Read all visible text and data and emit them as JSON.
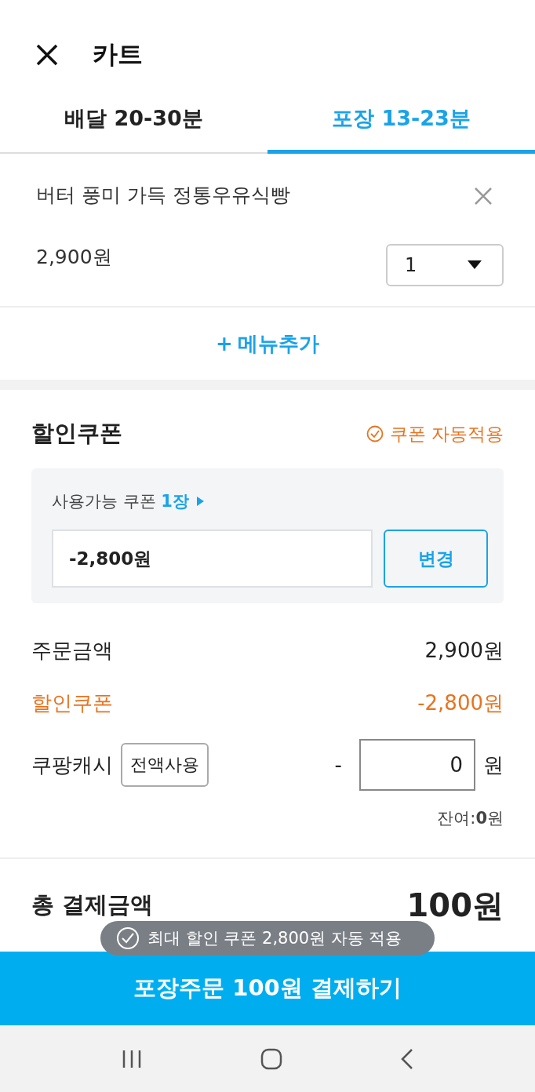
{
  "header": {
    "title": "카트"
  },
  "tabs": [
    {
      "label": "배달 20-30분",
      "selected": false
    },
    {
      "label": "포장 13-23분",
      "selected": true
    }
  ],
  "cart_item": {
    "name": "버터 풍미 가득 정통우유식빵",
    "price": "2,900원",
    "quantity": "1"
  },
  "add_menu": {
    "plus": "+",
    "label": "메뉴추가"
  },
  "coupon": {
    "title": "할인쿠폰",
    "auto_apply": {
      "label": "쿠폰 자동적용",
      "checked": true
    },
    "available": "사용가능 쿠폰 **1장**",
    "value": "-2,800원",
    "change_button": "변경"
  },
  "summary": {
    "order_label": "주문금액",
    "order_value": "2,900원",
    "discount_label": "할인쿠폰",
    "discount_value": "-2,800원",
    "cash_label": "쿠팡캐시",
    "use_all_button": "전액사용",
    "minus": "-",
    "cash_value": "0",
    "cash_unit": "원",
    "balance_label": "잔여:",
    "balance_value": "0원"
  },
  "total": {
    "label": "총 결제금액",
    "value": "100원"
  },
  "toast": "최대 할인 쿠폰 2,800원 자동 적용",
  "pay_button": "포장주문 100원 결제하기"
}
